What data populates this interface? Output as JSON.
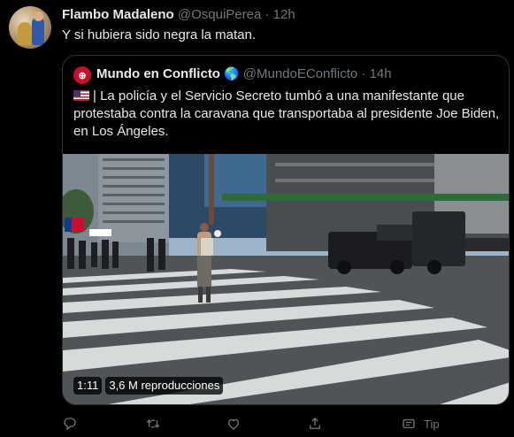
{
  "tweet": {
    "author_name": "Flambo Madaleno",
    "author_handle": "@OsquiPerea",
    "separator": "·",
    "time": "12h",
    "text": "Y si hubiera sido negra la matan."
  },
  "quote": {
    "author_name": "Mundo en Conflicto",
    "globe": "🌎",
    "author_handle": "@MundoEConflicto",
    "separator": "·",
    "time": "14h",
    "text": "| La policía y el Servicio Secreto tumbó a una manifestante que protestaba contra la caravana que transportaba al presidente Joe Biden, en Los Ángeles.",
    "media": {
      "duration": "1:11",
      "views": "3,6 M reproducciones"
    }
  },
  "actions": {
    "reply_icon": "reply-icon",
    "retweet_icon": "retweet-icon",
    "like_icon": "like-icon",
    "share_icon": "share-icon",
    "tip_label": "Tip"
  }
}
